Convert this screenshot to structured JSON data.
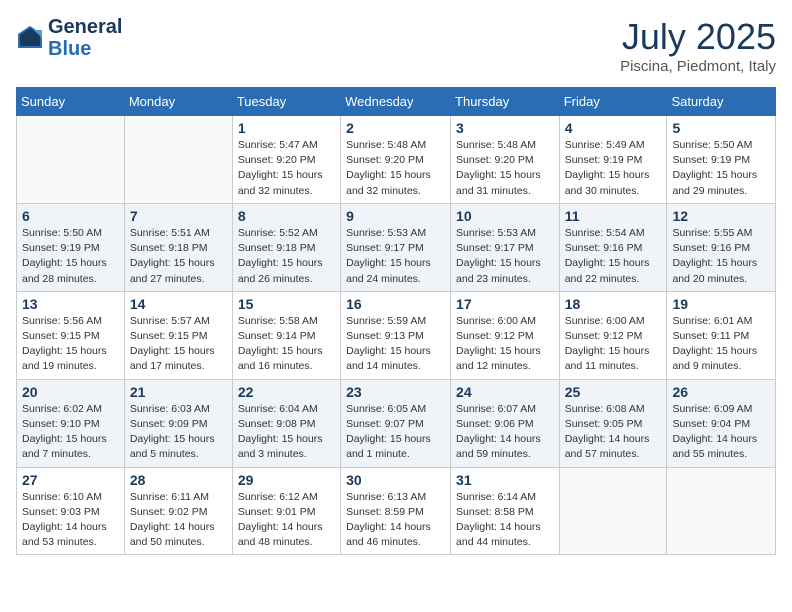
{
  "header": {
    "logo_line1": "General",
    "logo_line2": "Blue",
    "month": "July 2025",
    "location": "Piscina, Piedmont, Italy"
  },
  "weekdays": [
    "Sunday",
    "Monday",
    "Tuesday",
    "Wednesday",
    "Thursday",
    "Friday",
    "Saturday"
  ],
  "weeks": [
    [
      {
        "day": "",
        "info": ""
      },
      {
        "day": "",
        "info": ""
      },
      {
        "day": "1",
        "info": "Sunrise: 5:47 AM\nSunset: 9:20 PM\nDaylight: 15 hours\nand 32 minutes."
      },
      {
        "day": "2",
        "info": "Sunrise: 5:48 AM\nSunset: 9:20 PM\nDaylight: 15 hours\nand 32 minutes."
      },
      {
        "day": "3",
        "info": "Sunrise: 5:48 AM\nSunset: 9:20 PM\nDaylight: 15 hours\nand 31 minutes."
      },
      {
        "day": "4",
        "info": "Sunrise: 5:49 AM\nSunset: 9:19 PM\nDaylight: 15 hours\nand 30 minutes."
      },
      {
        "day": "5",
        "info": "Sunrise: 5:50 AM\nSunset: 9:19 PM\nDaylight: 15 hours\nand 29 minutes."
      }
    ],
    [
      {
        "day": "6",
        "info": "Sunrise: 5:50 AM\nSunset: 9:19 PM\nDaylight: 15 hours\nand 28 minutes."
      },
      {
        "day": "7",
        "info": "Sunrise: 5:51 AM\nSunset: 9:18 PM\nDaylight: 15 hours\nand 27 minutes."
      },
      {
        "day": "8",
        "info": "Sunrise: 5:52 AM\nSunset: 9:18 PM\nDaylight: 15 hours\nand 26 minutes."
      },
      {
        "day": "9",
        "info": "Sunrise: 5:53 AM\nSunset: 9:17 PM\nDaylight: 15 hours\nand 24 minutes."
      },
      {
        "day": "10",
        "info": "Sunrise: 5:53 AM\nSunset: 9:17 PM\nDaylight: 15 hours\nand 23 minutes."
      },
      {
        "day": "11",
        "info": "Sunrise: 5:54 AM\nSunset: 9:16 PM\nDaylight: 15 hours\nand 22 minutes."
      },
      {
        "day": "12",
        "info": "Sunrise: 5:55 AM\nSunset: 9:16 PM\nDaylight: 15 hours\nand 20 minutes."
      }
    ],
    [
      {
        "day": "13",
        "info": "Sunrise: 5:56 AM\nSunset: 9:15 PM\nDaylight: 15 hours\nand 19 minutes."
      },
      {
        "day": "14",
        "info": "Sunrise: 5:57 AM\nSunset: 9:15 PM\nDaylight: 15 hours\nand 17 minutes."
      },
      {
        "day": "15",
        "info": "Sunrise: 5:58 AM\nSunset: 9:14 PM\nDaylight: 15 hours\nand 16 minutes."
      },
      {
        "day": "16",
        "info": "Sunrise: 5:59 AM\nSunset: 9:13 PM\nDaylight: 15 hours\nand 14 minutes."
      },
      {
        "day": "17",
        "info": "Sunrise: 6:00 AM\nSunset: 9:12 PM\nDaylight: 15 hours\nand 12 minutes."
      },
      {
        "day": "18",
        "info": "Sunrise: 6:00 AM\nSunset: 9:12 PM\nDaylight: 15 hours\nand 11 minutes."
      },
      {
        "day": "19",
        "info": "Sunrise: 6:01 AM\nSunset: 9:11 PM\nDaylight: 15 hours\nand 9 minutes."
      }
    ],
    [
      {
        "day": "20",
        "info": "Sunrise: 6:02 AM\nSunset: 9:10 PM\nDaylight: 15 hours\nand 7 minutes."
      },
      {
        "day": "21",
        "info": "Sunrise: 6:03 AM\nSunset: 9:09 PM\nDaylight: 15 hours\nand 5 minutes."
      },
      {
        "day": "22",
        "info": "Sunrise: 6:04 AM\nSunset: 9:08 PM\nDaylight: 15 hours\nand 3 minutes."
      },
      {
        "day": "23",
        "info": "Sunrise: 6:05 AM\nSunset: 9:07 PM\nDaylight: 15 hours\nand 1 minute."
      },
      {
        "day": "24",
        "info": "Sunrise: 6:07 AM\nSunset: 9:06 PM\nDaylight: 14 hours\nand 59 minutes."
      },
      {
        "day": "25",
        "info": "Sunrise: 6:08 AM\nSunset: 9:05 PM\nDaylight: 14 hours\nand 57 minutes."
      },
      {
        "day": "26",
        "info": "Sunrise: 6:09 AM\nSunset: 9:04 PM\nDaylight: 14 hours\nand 55 minutes."
      }
    ],
    [
      {
        "day": "27",
        "info": "Sunrise: 6:10 AM\nSunset: 9:03 PM\nDaylight: 14 hours\nand 53 minutes."
      },
      {
        "day": "28",
        "info": "Sunrise: 6:11 AM\nSunset: 9:02 PM\nDaylight: 14 hours\nand 50 minutes."
      },
      {
        "day": "29",
        "info": "Sunrise: 6:12 AM\nSunset: 9:01 PM\nDaylight: 14 hours\nand 48 minutes."
      },
      {
        "day": "30",
        "info": "Sunrise: 6:13 AM\nSunset: 8:59 PM\nDaylight: 14 hours\nand 46 minutes."
      },
      {
        "day": "31",
        "info": "Sunrise: 6:14 AM\nSunset: 8:58 PM\nDaylight: 14 hours\nand 44 minutes."
      },
      {
        "day": "",
        "info": ""
      },
      {
        "day": "",
        "info": ""
      }
    ]
  ]
}
